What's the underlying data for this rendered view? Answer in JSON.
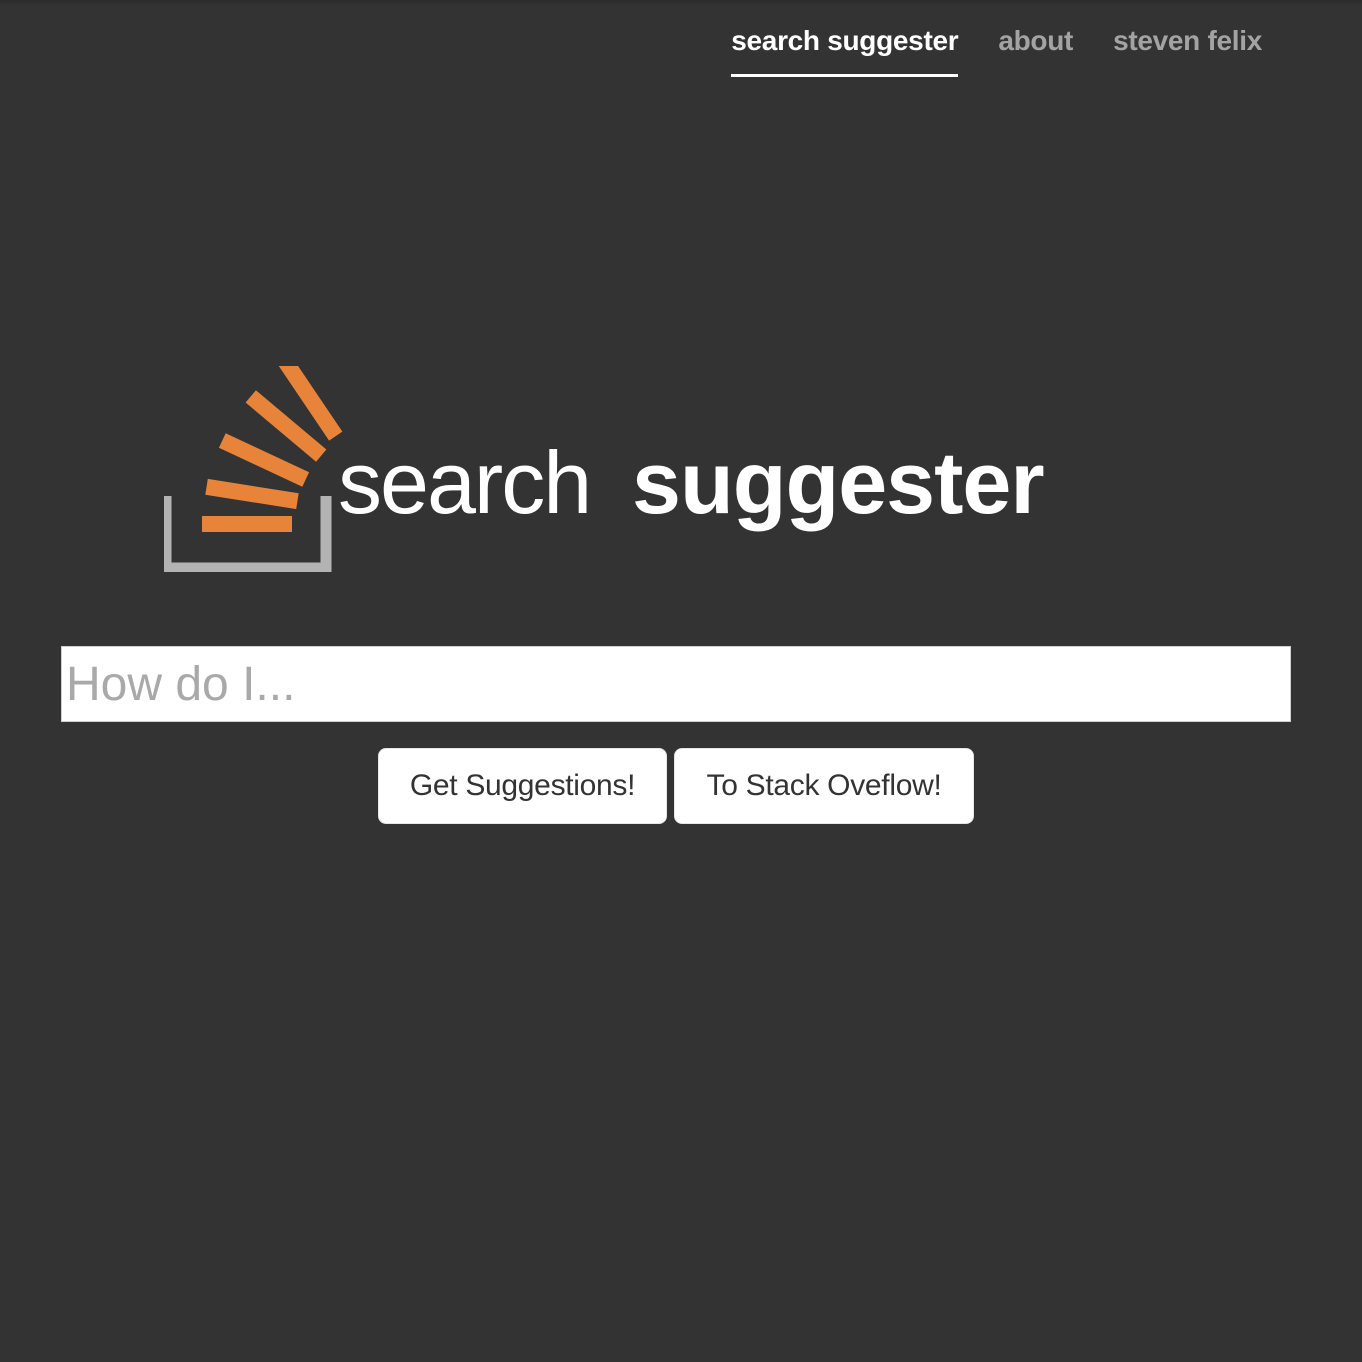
{
  "nav": {
    "items": [
      {
        "label": "search suggester",
        "active": true
      },
      {
        "label": "about",
        "active": false
      },
      {
        "label": "steven felix",
        "active": false
      }
    ]
  },
  "logo": {
    "word_light": "search",
    "word_bold": "suggester",
    "icon": "stack-overflow-icon"
  },
  "search": {
    "placeholder": "How do I...",
    "value": ""
  },
  "actions": {
    "suggest_label": "Get Suggestions!",
    "stack_label": "To Stack Oveflow!"
  },
  "colors": {
    "background": "#333333",
    "accent_orange": "#e8843a",
    "tray_gray": "#b3b3b3",
    "text_white": "#ffffff"
  }
}
